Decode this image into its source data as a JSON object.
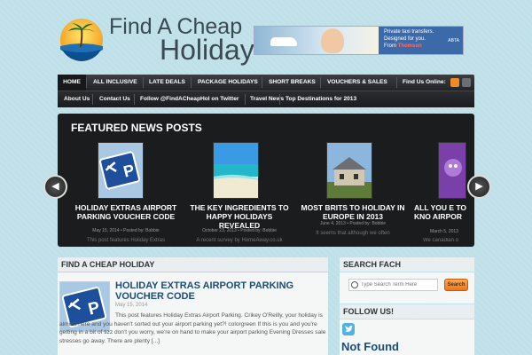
{
  "site": {
    "logo_line1": "Find A Cheap",
    "logo_line2": "Holiday"
  },
  "banner_ad": {
    "lines": [
      "Private taxi transfers.",
      "Designed for you."
    ],
    "from_label": "From",
    "brand": "Thomson",
    "badge": "ABTA"
  },
  "nav_primary": {
    "items": [
      "HOME",
      "ALL INCLUSIVE",
      "LATE DEALS",
      "PACKAGE HOLIDAYS",
      "SHORT BREAKS",
      "VOUCHERS & SALES"
    ],
    "social_label": "Find Us Online:"
  },
  "nav_secondary": {
    "items": [
      "About Us",
      "Contact Us",
      "Follow @FindACheapHol on Twitter",
      "Travel News",
      "Top Destinations for 2013"
    ]
  },
  "featured": {
    "title": "FEATURED NEWS POSTS",
    "prev_icon": "◀",
    "next_icon": "▶",
    "posts": [
      {
        "title": "HOLIDAY EXTRAS AIRPORT PARKING VOUCHER CODE",
        "meta": "May 15, 2014 • Posted by: Bobbie",
        "excerpt": "This post features Holiday Extras",
        "image": "parking-sign"
      },
      {
        "title": "THE KEY INGREDIENTS TO HAPPY HOLIDAYS REVEALED",
        "meta": "October 23, 2013 • Posted by: Bobbie",
        "excerpt": "A recent survey by HomeAway.co.uk",
        "image": "beach"
      },
      {
        "title": "MOST BRITS TO HOLIDAY IN EUROPE IN 2013",
        "meta": "June 4, 2013 • Posted by: Bobbie",
        "excerpt": "It seems that although we often",
        "image": "cottage"
      },
      {
        "title": "ALL YOU E TO KNO AIRPOR",
        "meta": "March 5, 2013",
        "excerpt": "We canadian o",
        "image": "purple-figure"
      }
    ]
  },
  "main": {
    "heading": "FIND A CHEAP HOLIDAY",
    "post": {
      "title": "HOLIDAY EXTRAS AIRPORT PARKING VOUCHER CODE",
      "date": "May 15, 2014",
      "body": "This post features Holiday Extras Airport Parking. Crikey O'Reilly, your holiday is almost here and you haven't sorted out your airport parking yet?! colorgreen If this is you and you're getting in a bit of tizz don't you worry, we're on hand to make your airport parking Evening Dresses sale stresses go away. There are plenty [...]"
    }
  },
  "sidebar": {
    "search_heading": "SEARCH FACH",
    "search_placeholder": "Type Search Term Here",
    "search_button": "Search",
    "follow_heading": "FOLLOW US!",
    "not_found": "Not Found"
  },
  "colors": {
    "background": "#bfe0e8",
    "nav": "#222427",
    "link_blue": "#1b4c7a",
    "accent_orange": "#e8771b"
  }
}
